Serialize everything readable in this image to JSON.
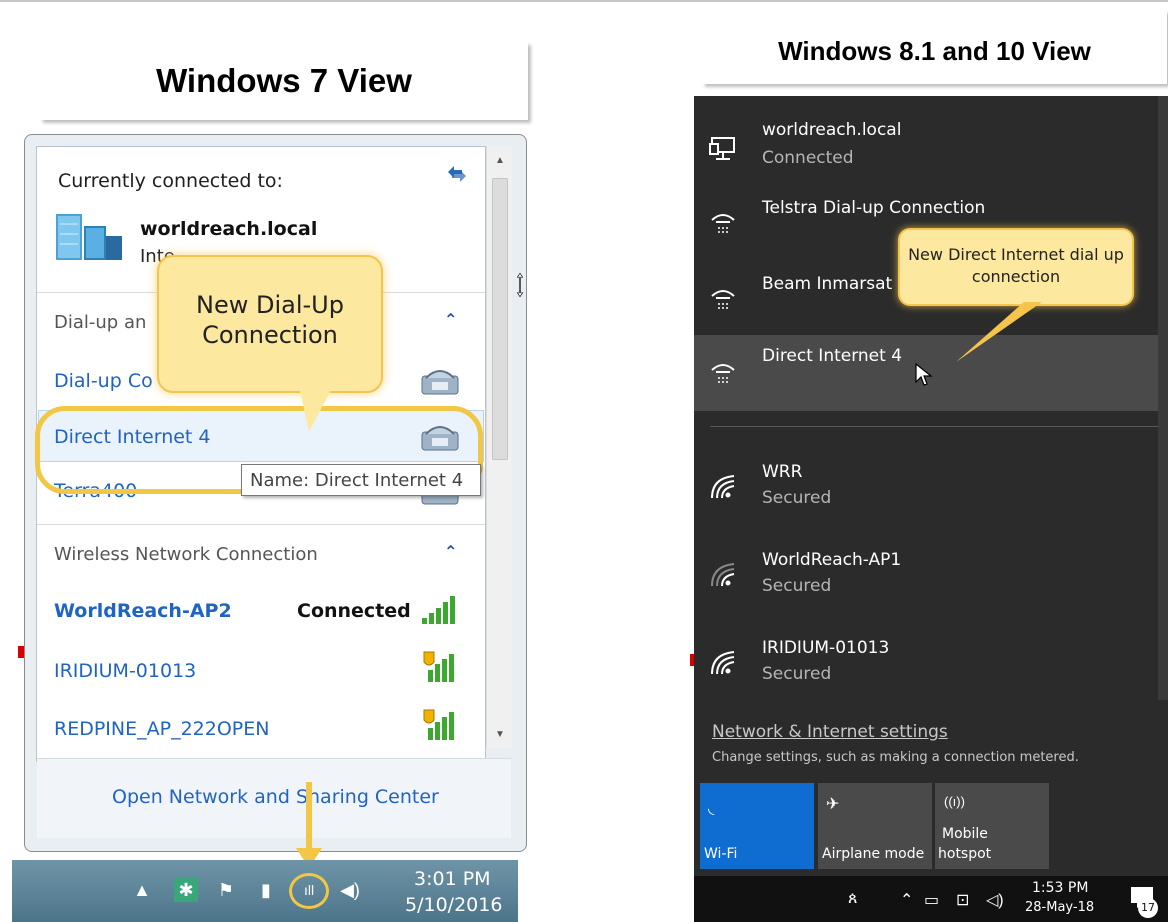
{
  "win7": {
    "title": "Windows 7 View",
    "currently_connected": "Currently connected to:",
    "network_name": "worldreach.local",
    "network_sub": "Inte",
    "dialup_group": "Dial-up an",
    "dialup_item_1": "Dial-up Co",
    "dialup_item_2": "Direct Internet 4",
    "dialup_item_3": "Terra400",
    "tooltip": "Name: Direct Internet 4",
    "callout": "New Dial-Up Connection",
    "wireless_group": "Wireless Network Connection",
    "wifi_connected_name": "WorldReach-AP2",
    "wifi_connected_status": "Connected",
    "wifi_2": "IRIDIUM-01013",
    "wifi_3": "REDPINE_AP_222OPEN",
    "footer_link": "Open Network and Sharing Center",
    "time": "3:01 PM",
    "date": "5/10/2016",
    "accent_color": "#f2c745"
  },
  "win10": {
    "title": "Windows 8.1 and 10 View",
    "networks": [
      {
        "name": "worldreach.local",
        "sub": "Connected"
      },
      {
        "name": "Telstra Dial-up Connection",
        "sub": ""
      },
      {
        "name": "Beam Inmarsat",
        "sub": ""
      },
      {
        "name": "Direct Internet 4",
        "sub": ""
      }
    ],
    "wifi": [
      {
        "name": "WRR",
        "sub": "Secured"
      },
      {
        "name": "WorldReach-AP1",
        "sub": "Secured"
      },
      {
        "name": "IRIDIUM-01013",
        "sub": "Secured"
      }
    ],
    "callout": "New Direct Internet dial up connection",
    "settings_link": "Network & Internet settings",
    "settings_sub": "Change settings, such as making a connection metered.",
    "tiles": {
      "wifi": "Wi-Fi",
      "airplane": "Airplane mode",
      "hotspot_1": "Mobile",
      "hotspot_2": "hotspot"
    },
    "time": "1:53 PM",
    "date": "28-May-18",
    "notification_count": "17",
    "tile_accent": "#0f6dd1"
  }
}
